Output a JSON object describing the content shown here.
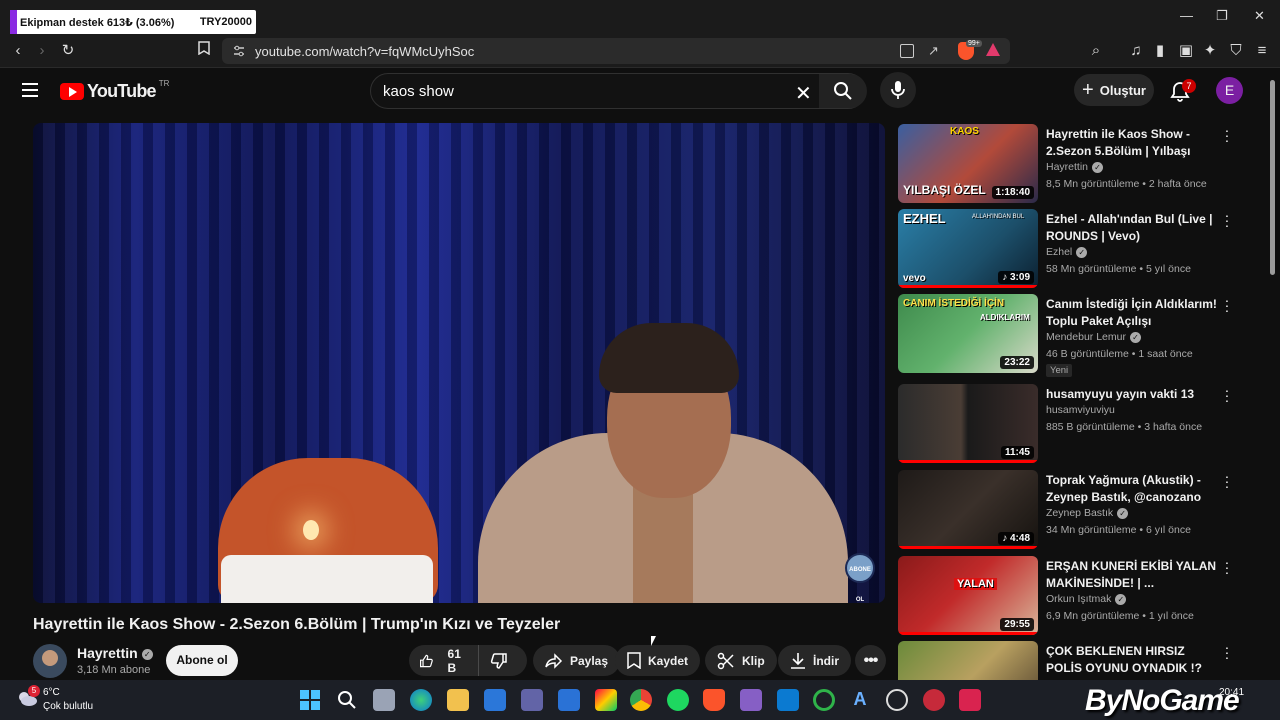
{
  "browser": {
    "tab_title": "Ekipman destek  613₺ (3.06%)",
    "tab_right": "TRY20000",
    "url": "youtube.com/watch?v=fqWMcUyhSoc",
    "brave_badge": "99+"
  },
  "header": {
    "logo": "YouTube",
    "region": "TR",
    "search_query": "kaos show",
    "create_label": "Oluştur",
    "notifications_count": "7",
    "avatar_initial": "E"
  },
  "video": {
    "title": "Hayrettin ile Kaos Show - 2.Sezon 6.Bölüm | Trump'ın Kızı ve Teyzeler",
    "channel": "Hayrettin",
    "subscribers": "3,18 Mn abone",
    "subscribe_label": "Abone ol",
    "likes": "61 B",
    "share_label": "Paylaş",
    "save_label": "Kaydet",
    "clip_label": "Klip",
    "download_label": "İndir",
    "overlay_badge": "ABONE OL"
  },
  "recommendations": [
    {
      "title": "Hayrettin ile Kaos Show - 2.Sezon 5.Bölüm | Yılbaşı Özel...",
      "channel": "Hayrettin",
      "verified": true,
      "meta": "8,5 Mn görüntüleme • 2 hafta önce",
      "duration": "1:18:40",
      "thumb_text": "YILBAŞI ÖZEL",
      "thumb_text_2": "KAOS",
      "new": "",
      "progress": 0.0
    },
    {
      "title": "Ezhel - Allah'ından Bul (Live | ROUNDS | Vevo)",
      "channel": "Ezhel",
      "verified": true,
      "meta": "58 Mn görüntüleme • 5 yıl önce",
      "duration": "3:09",
      "thumb_text": "EZHEL",
      "thumb_text_2": "ALLAH'INDAN BUL",
      "thumb_text_3": "vevo",
      "new": "",
      "progress": 1.0
    },
    {
      "title": "Canım İstediği İçin Aldıklarım! Toplu Paket Açılışı",
      "channel": "Mendebur Lemur",
      "verified": true,
      "meta": "46 B görüntüleme • 1 saat önce",
      "duration": "23:22",
      "thumb_text": "CANIM İSTEDİĞİ İÇİN",
      "thumb_text_2": "ALDIKLARIM",
      "new": "Yeni",
      "progress": 0.0
    },
    {
      "title": "husamyuyu yayın vakti 13",
      "channel": "husamviyuviyu",
      "verified": false,
      "meta": "885 B görüntüleme • 3 hafta önce",
      "duration": "11:45",
      "thumb_text": "",
      "new": "",
      "progress": 1.0
    },
    {
      "title": "Toprak Yağmura (Akustik) - Zeynep Bastık, @canozano",
      "channel": "Zeynep Bastık",
      "verified": true,
      "meta": "34 Mn görüntüleme • 6 yıl önce",
      "duration": "4:48",
      "thumb_text": "",
      "new": "",
      "progress": 1.0
    },
    {
      "title": "ERŞAN KUNERİ EKİBİ YALAN MAKİNESİNDE! | ...",
      "channel": "Orkun Işıtmak",
      "verified": true,
      "meta": "6,9 Mn görüntüleme • 1 yıl önce",
      "duration": "29:55",
      "thumb_text": "YALAN",
      "new": "",
      "progress": 1.0
    },
    {
      "title": "ÇOK BEKLENEN HIRSIZ POLİS OYUNU OYNADIK !? @Sefa ...",
      "channel": "",
      "verified": false,
      "meta": "",
      "duration": "",
      "thumb_text": "",
      "new": "",
      "progress": 0.0
    }
  ],
  "taskbar": {
    "weather_temp": "6°C",
    "weather_desc": "Çok bulutlu",
    "weather_badge": "5",
    "clock": "20:41"
  },
  "watermark": "ByNoGame",
  "colors": {
    "accent": "#ff0000",
    "background": "#0f0f0f",
    "avatar": "#7b1fa2"
  }
}
